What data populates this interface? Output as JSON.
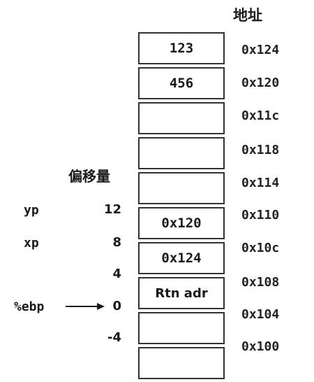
{
  "header": {
    "address_label": "地址"
  },
  "offset_header": "偏移量",
  "cells": [
    {
      "value": "123"
    },
    {
      "value": "456"
    },
    {
      "value": ""
    },
    {
      "value": ""
    },
    {
      "value": ""
    },
    {
      "value": "0x120"
    },
    {
      "value": "0x124"
    },
    {
      "value": "Rtn adr"
    },
    {
      "value": ""
    },
    {
      "value": ""
    }
  ],
  "addresses": [
    "0x124",
    "0x120",
    "0x11c",
    "0x118",
    "0x114",
    "0x110",
    "0x10c",
    "0x108",
    "0x104",
    "0x100"
  ],
  "offsets": [
    "12",
    "8",
    "4",
    "0",
    "-4"
  ],
  "variables": [
    "yp",
    "xp"
  ],
  "ebp_label": "%ebp"
}
